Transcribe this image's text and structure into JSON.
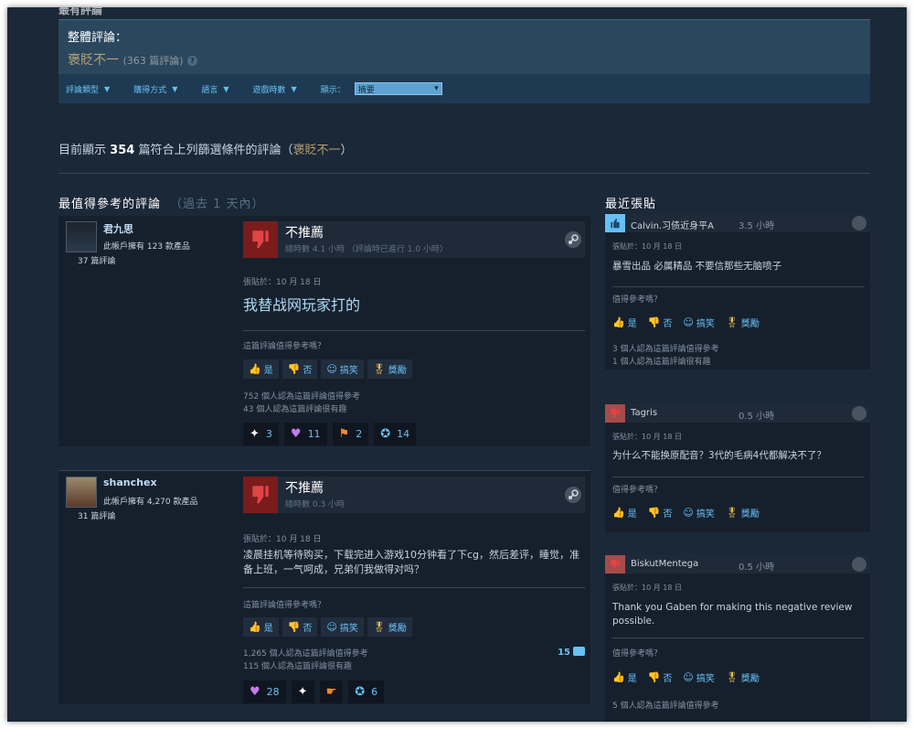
{
  "header": {
    "cut_title": "最有評論",
    "summary_label": "整體評論：",
    "summary_value": "褒貶不一",
    "summary_count": "(363 篇評論)",
    "summary_help": "?"
  },
  "filters": {
    "items": [
      "評論類型",
      "購得方式",
      "語言",
      "遊戲時數"
    ],
    "display_label": "顯示：",
    "display_value": "摘要"
  },
  "current": {
    "prefix": "目前顯示",
    "count": "354",
    "middle": "篇符合上列篩選條件的評論（",
    "rating": "褒貶不一",
    "suffix": "）"
  },
  "sections": {
    "helpful_title": "最值得參考的評論",
    "helpful_sub": "（過去 1 天內）",
    "recent_title": "最近張貼"
  },
  "reviews": [
    {
      "username": "君九思",
      "products": "此帳戶擁有 123 款產品",
      "reviews": "37 篇評論",
      "verdict": "不推薦",
      "hours": "總時數 4.1 小時 （評論時已進行 1.0 小時）",
      "posted": "張貼於：10 月 18 日",
      "body": "我替战网玩家打的",
      "helpful_q": "這篇評論值得參考嗎？",
      "votes": [
        "是",
        "否",
        "搞笑",
        "獎勵"
      ],
      "stat1": "752 個人認為這篇評論值得參考",
      "stat2": "43 個人認為這篇評論很有趣",
      "awards": [
        "3",
        "11",
        "2",
        "14"
      ]
    },
    {
      "username": "shanchex",
      "products": "此帳戶擁有 4,270 款產品",
      "reviews": "31 篇評論",
      "verdict": "不推薦",
      "hours": "總時數 0.3 小時",
      "posted": "張貼於：10 月 18 日",
      "body": "凌晨挂机等待购买，下载完进入游戏10分钟看了下cg，然后差评，睡觉，准备上班，一气呵成，兄弟们我做得对吗？",
      "helpful_q": "這篇評論值得參考嗎？",
      "votes": [
        "是",
        "否",
        "搞笑",
        "獎勵"
      ],
      "stat1": "1,265 個人認為這篇評論值得參考",
      "stat2": "115 個人認為這篇評論很有趣",
      "comments": "15",
      "awards": [
        "28",
        "",
        "",
        "6"
      ]
    }
  ],
  "posts": [
    {
      "name": "Calvin.习债近身平A",
      "hours": "3.5 小時",
      "date": "張貼於：10 月 18 日",
      "text": "暴雪出品 必属精品 不要信那些无脑喷子",
      "q": "值得參考嗎？",
      "votes": [
        "是",
        "否",
        "搞笑",
        "獎勵"
      ],
      "stat1": "3 個人認為這篇評論值得參考",
      "stat2": "1 個人認為這篇評論很有趣"
    },
    {
      "name": "Tagris",
      "hours": "0.5 小時",
      "date": "張貼於：10 月 18 日",
      "text": "为什么不能换原配音？3代的毛病4代都解决不了？",
      "q": "值得參考嗎？",
      "votes": [
        "是",
        "否",
        "搞笑",
        "獎勵"
      ]
    },
    {
      "name": "BiskutMentega",
      "hours": "0.5 小時",
      "date": "張貼於：10 月 18 日",
      "text": "Thank you Gaben for making this negative review possible.",
      "q": "值得參考嗎？",
      "votes": [
        "是",
        "否",
        "搞笑",
        "獎勵"
      ],
      "stat1": "5 個人認為這篇評論值得參考"
    }
  ]
}
